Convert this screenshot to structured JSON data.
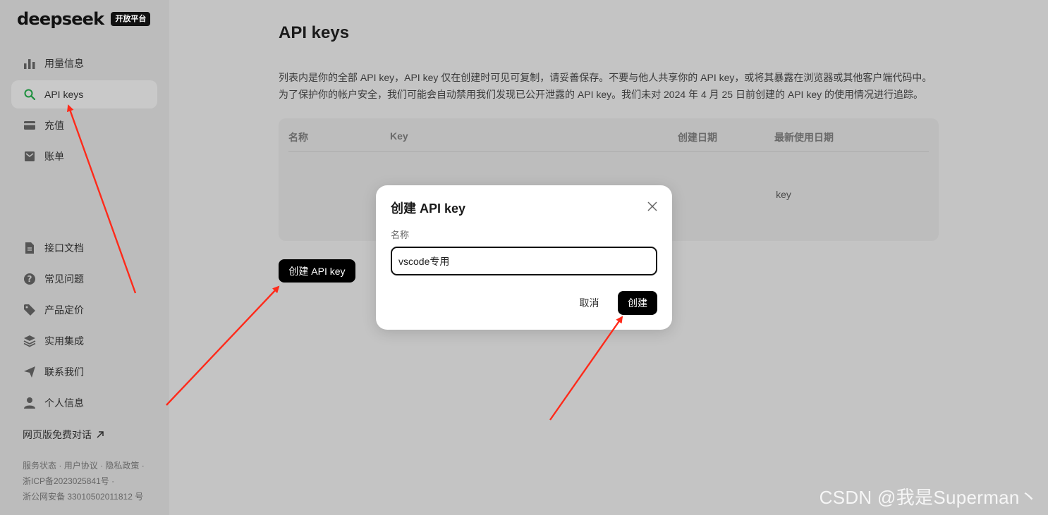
{
  "brand": {
    "name": "deepseek",
    "badge": "开放平台"
  },
  "sidebar": {
    "items": [
      {
        "label": "用量信息",
        "icon": "bar-chart-icon",
        "active": false
      },
      {
        "label": "API keys",
        "icon": "search-icon",
        "active": true
      },
      {
        "label": "充值",
        "icon": "card-icon",
        "active": false
      },
      {
        "label": "账单",
        "icon": "bill-icon",
        "active": false
      }
    ],
    "items_bottom": [
      {
        "label": "接口文档",
        "icon": "document-icon"
      },
      {
        "label": "常见问题",
        "icon": "question-icon"
      },
      {
        "label": "产品定价",
        "icon": "tag-icon"
      },
      {
        "label": "实用集成",
        "icon": "layers-icon"
      },
      {
        "label": "联系我们",
        "icon": "send-icon"
      },
      {
        "label": "个人信息",
        "icon": "user-icon"
      }
    ],
    "web_chat": "网页版免费对话",
    "footer": {
      "service_status": "服务状态",
      "user_agreement": "用户协议",
      "privacy_policy": "隐私政策",
      "icp": "浙ICP备2023025841号",
      "police": "浙公网安备 33010502011812 号"
    }
  },
  "main": {
    "title": "API keys",
    "description_line1": "列表内是你的全部 API key，API key 仅在创建时可见可复制，请妥善保存。不要与他人共享你的 API key，或将其暴露在浏览器或其他客户端代码中。",
    "description_line2": "为了保护你的帐户安全，我们可能会自动禁用我们发现已公开泄露的 API key。我们未对 2024 年 4 月 25 日前创建的 API key 的使用情况进行追踪。",
    "table": {
      "headers": [
        "名称",
        "Key",
        "创建日期",
        "最新使用日期"
      ],
      "empty_text": "key"
    },
    "create_button": "创建 API key"
  },
  "modal": {
    "title": "创建 API key",
    "field_label": "名称",
    "input_value": "vscode专用",
    "cancel": "取消",
    "confirm": "创建"
  },
  "watermark": "CSDN @我是Superman丶",
  "colors": {
    "arrow": "#ff2a1a",
    "active_icon": "#1a8f3c"
  }
}
